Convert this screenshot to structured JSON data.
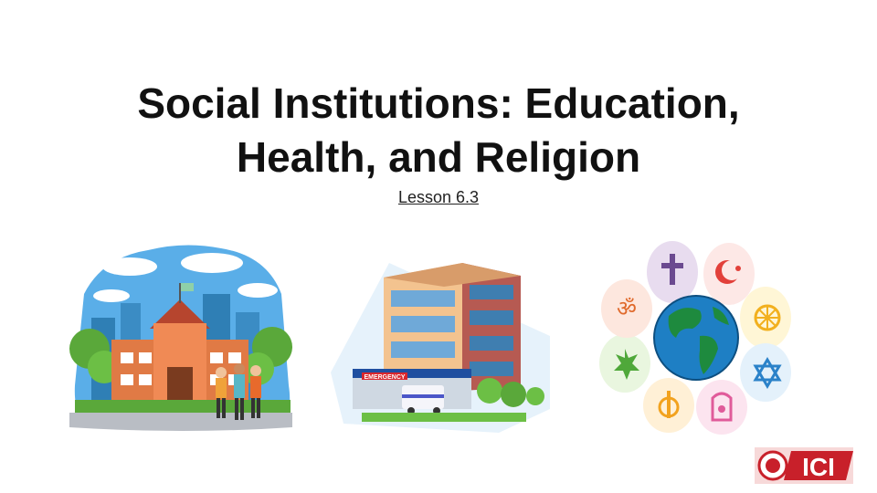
{
  "slide": {
    "title_line1": "Social Institutions: Education,",
    "title_line2": "Health, and Religion",
    "subtitle": "Lesson 6.3"
  },
  "illustrations": {
    "school": {
      "icon": "school-illustration"
    },
    "hospital": {
      "icon": "hospital-illustration",
      "sign": "EMERGENCY"
    },
    "religion": {
      "icon": "world-religions-flower",
      "symbols": [
        "om",
        "cross",
        "crescent-star",
        "dharma-wheel",
        "star-of-david",
        "jain-hand",
        "khanda",
        "bahai-star"
      ]
    }
  },
  "logo": {
    "text": "ICI"
  },
  "colors": {
    "title": "#111111",
    "sky": "#5aaee8",
    "school_wall": "#e07a45",
    "hospital_wall_left": "#f3c38f",
    "hospital_wall_right": "#b65a52",
    "emergency_sign": "#d9262c",
    "globe_ocean": "#1e7fc4",
    "globe_land": "#1e8a3e",
    "logo_red": "#c8202a"
  }
}
